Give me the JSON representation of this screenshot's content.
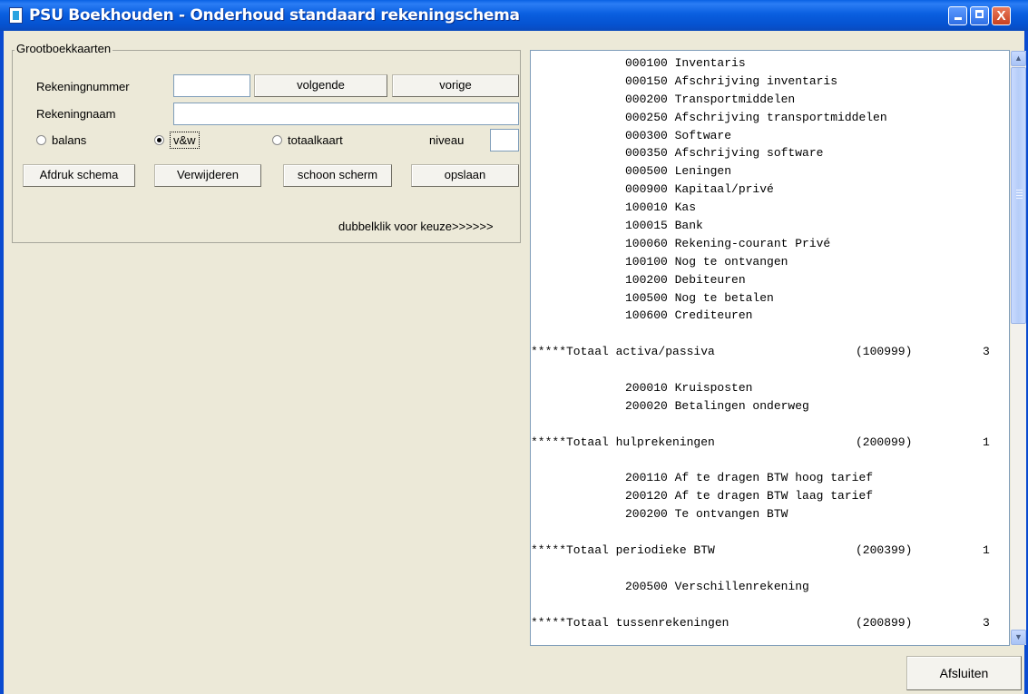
{
  "window": {
    "title": "PSU Boekhouden - Onderhoud standaard rekeningschema",
    "controls": {
      "minimize": "minimize",
      "maximize": "maximize",
      "close": "X"
    }
  },
  "form": {
    "group_title": "Grootboekkaarten",
    "rekeningnummer_label": "Rekeningnummer",
    "rekeningnummer_value": "",
    "rekeningnaam_label": "Rekeningnaam",
    "rekeningnaam_value": "",
    "next_button": "volgende",
    "prev_button": "vorige",
    "radio_balans": "balans",
    "radio_venw": "v&w",
    "radio_totaalkaart": "totaalkaart",
    "selected_radio": "v&w",
    "niveau_label": "niveau",
    "niveau_value": "",
    "print_button": "Afdruk schema",
    "delete_button": "Verwijderen",
    "clear_button": "schoon scherm",
    "save_button": "opslaan",
    "hint": "dubbelklik voor keuze>>>>>>"
  },
  "listing": {
    "rows": [
      {
        "type": "account",
        "text": "000100 Inventaris"
      },
      {
        "type": "account",
        "text": "000150 Afschrijving inventaris"
      },
      {
        "type": "account",
        "text": "000200 Transportmiddelen"
      },
      {
        "type": "account",
        "text": "000250 Afschrijving transportmiddelen"
      },
      {
        "type": "account",
        "text": "000300 Software"
      },
      {
        "type": "account",
        "text": "000350 Afschrijving software"
      },
      {
        "type": "account",
        "text": "000500 Leningen"
      },
      {
        "type": "account",
        "text": "000900 Kapitaal/privé"
      },
      {
        "type": "account",
        "text": "100010 Kas"
      },
      {
        "type": "account",
        "text": "100015 Bank"
      },
      {
        "type": "account",
        "text": "100060 Rekening-courant Privé"
      },
      {
        "type": "account",
        "text": "100100 Nog te ontvangen"
      },
      {
        "type": "account",
        "text": "100200 Debiteuren"
      },
      {
        "type": "account",
        "text": "100500 Nog te betalen"
      },
      {
        "type": "account",
        "text": "100600 Crediteuren"
      },
      {
        "type": "blank"
      },
      {
        "type": "total",
        "text": "*****Totaal activa/passiva",
        "ref": "(100999)",
        "level": "3"
      },
      {
        "type": "blank"
      },
      {
        "type": "account",
        "text": "200010 Kruisposten"
      },
      {
        "type": "account",
        "text": "200020 Betalingen onderweg"
      },
      {
        "type": "blank"
      },
      {
        "type": "total",
        "text": "*****Totaal hulprekeningen",
        "ref": "(200099)",
        "level": "1"
      },
      {
        "type": "blank"
      },
      {
        "type": "account",
        "text": "200110 Af te dragen BTW hoog tarief"
      },
      {
        "type": "account",
        "text": "200120 Af te dragen BTW laag tarief"
      },
      {
        "type": "account",
        "text": "200200 Te ontvangen BTW"
      },
      {
        "type": "blank"
      },
      {
        "type": "total",
        "text": "*****Totaal periodieke BTW",
        "ref": "(200399)",
        "level": "1"
      },
      {
        "type": "blank"
      },
      {
        "type": "account",
        "text": "200500 Verschillenrekening"
      },
      {
        "type": "blank"
      },
      {
        "type": "total",
        "text": "*****Totaal tussenrekeningen",
        "ref": "(200899)",
        "level": "3"
      }
    ]
  },
  "footer": {
    "close_button": "Afsluiten"
  },
  "colors": {
    "titlebar": "#0a5fe0",
    "window_bg": "#ece9d8",
    "listing_bg": "#ffffff"
  }
}
